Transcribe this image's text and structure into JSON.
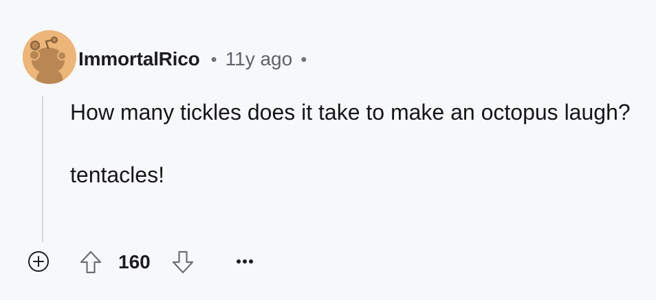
{
  "comment": {
    "author": "ImmortalRico",
    "separator": "•",
    "timestamp": "11y ago",
    "paragraphs": [
      "How many tickles does it take to make an octopus laugh?",
      "tentacles!"
    ],
    "score": "160"
  },
  "icons": {
    "avatar": "reddit-snoo-avatar-icon",
    "expand": "plus-circle-icon",
    "upvote": "arrow-up-icon",
    "downvote": "arrow-down-icon",
    "more": "ellipsis-icon"
  },
  "colors": {
    "background": "#f7f8fa",
    "avatar_background": "#ecb57a",
    "avatar_figure": "#b88753",
    "thread_line": "#d5d9dd",
    "meta_text": "#5d6369"
  }
}
